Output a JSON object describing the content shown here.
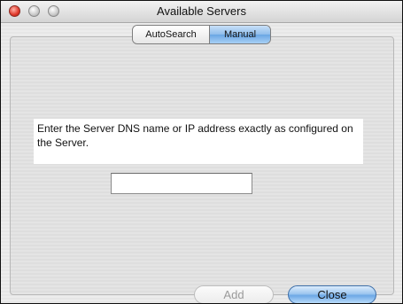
{
  "window": {
    "title": "Available Servers"
  },
  "tabs": [
    {
      "label": "AutoSearch",
      "selected": false
    },
    {
      "label": "Manual",
      "selected": true
    }
  ],
  "manual": {
    "instruction": "Enter the Server DNS name or IP address exactly as configured on the Server.",
    "address_value": "",
    "address_placeholder": ""
  },
  "buttons": {
    "add_label": "Add",
    "add_enabled": false,
    "close_label": "Close",
    "close_default": true
  },
  "colors": {
    "accent": "#6aa6e4",
    "close_traffic_light": "#e0382a"
  }
}
